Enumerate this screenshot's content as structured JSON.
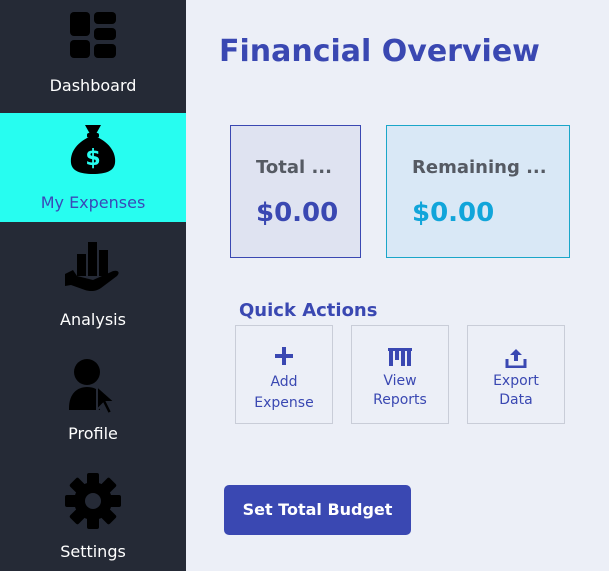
{
  "sidebar": {
    "items": [
      {
        "label": "Dashboard",
        "icon": "dashboard-grid-icon"
      },
      {
        "label": "My Expenses",
        "icon": "money-bag-icon",
        "active": true
      },
      {
        "label": "Analysis",
        "icon": "hand-chart-icon"
      },
      {
        "label": "Profile",
        "icon": "user-pointer-icon"
      },
      {
        "label": "Settings",
        "icon": "gear-icon"
      }
    ]
  },
  "main": {
    "title": "Financial Overview",
    "cards": {
      "total": {
        "label": "Total ...",
        "value": "$0.00"
      },
      "remaining": {
        "label": "Remaining ...",
        "value": "$0.00"
      }
    },
    "quick_actions": {
      "title": "Quick Actions",
      "items": [
        {
          "label_line1": "Add",
          "label_line2": "Expense",
          "icon": "plus-icon"
        },
        {
          "label_line1": "View",
          "label_line2": "Reports",
          "icon": "reports-icon"
        },
        {
          "label_line1": "Export",
          "label_line2": "Data",
          "icon": "upload-icon"
        }
      ]
    },
    "budget_button": "Set Total Budget"
  },
  "colors": {
    "sidebar_bg": "#252a36",
    "active_bg": "#27fdf0",
    "accent": "#3a48b2",
    "teal": "#11a5da",
    "page_bg": "#eceff7"
  }
}
